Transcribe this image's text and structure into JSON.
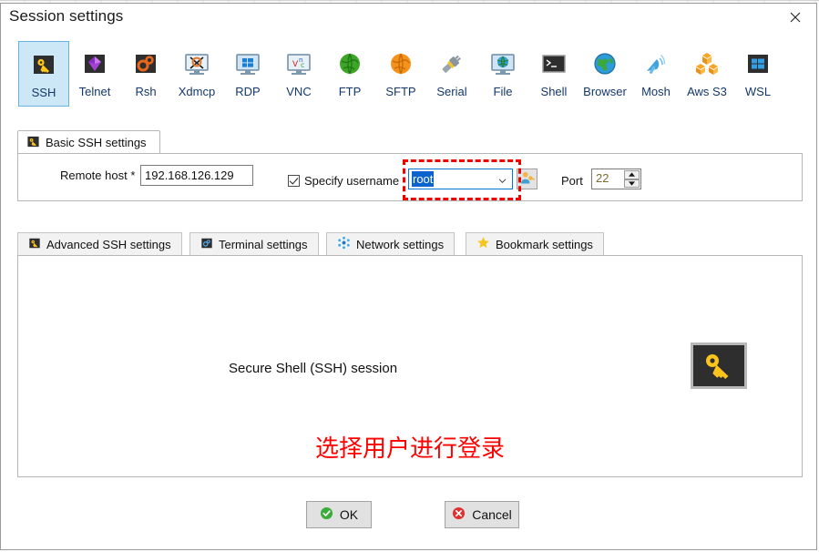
{
  "window": {
    "title": "Session settings",
    "close_icon": "close-icon"
  },
  "protocols": [
    {
      "label": "SSH",
      "icon": "ssh-key-icon",
      "selected": true
    },
    {
      "label": "Telnet",
      "icon": "telnet-gem-icon",
      "selected": false
    },
    {
      "label": "Rsh",
      "icon": "rsh-gears-icon",
      "selected": false
    },
    {
      "label": "Xdmcp",
      "icon": "xdmcp-x-icon",
      "selected": false
    },
    {
      "label": "RDP",
      "icon": "rdp-monitor-icon",
      "selected": false
    },
    {
      "label": "VNC",
      "icon": "vnc-monitor-icon",
      "selected": false
    },
    {
      "label": "FTP",
      "icon": "ftp-globe-icon",
      "selected": false
    },
    {
      "label": "SFTP",
      "icon": "sftp-globe-icon",
      "selected": false
    },
    {
      "label": "Serial",
      "icon": "serial-plug-icon",
      "selected": false
    },
    {
      "label": "File",
      "icon": "file-monitor-icon",
      "selected": false
    },
    {
      "label": "Shell",
      "icon": "shell-prompt-icon",
      "selected": false
    },
    {
      "label": "Browser",
      "icon": "browser-globe-icon",
      "selected": false
    },
    {
      "label": "Mosh",
      "icon": "mosh-dish-icon",
      "selected": false
    },
    {
      "label": "Aws S3",
      "icon": "aws-s3-cubes-icon",
      "selected": false
    },
    {
      "label": "WSL",
      "icon": "wsl-windows-icon",
      "selected": false
    }
  ],
  "basic_tab": {
    "label": "Basic SSH settings",
    "icon": "ssh-key-icon"
  },
  "basic_settings": {
    "remote_host_label": "Remote host *",
    "remote_host_value": "192.168.126.129",
    "remote_host_placeholder": "Remote host",
    "specify_username_label": "Specify username",
    "specify_username_checked": true,
    "username_value": "root",
    "username_placeholder": "username",
    "username_dropdown_icon": "chevron-down-icon",
    "select_user_button_icon": "user-key-icon",
    "port_label": "Port",
    "port_value": "22",
    "port_up_icon": "spinner-up-icon",
    "port_down_icon": "spinner-down-icon"
  },
  "sub_tabs": [
    {
      "label": "Advanced SSH settings",
      "icon": "ssh-key-icon"
    },
    {
      "label": "Terminal settings",
      "icon": "terminal-icon"
    },
    {
      "label": "Network settings",
      "icon": "network-nodes-icon"
    },
    {
      "label": "Bookmark settings",
      "icon": "star-icon"
    }
  ],
  "content": {
    "session_title": "Secure Shell (SSH) session",
    "session_icon": "ssh-key-large-icon"
  },
  "annotations": {
    "username_highlight_color": "#ff0000",
    "callout_text": "选择用户进行登录",
    "callout_color": "#ff0000"
  },
  "footer": {
    "ok_label": "OK",
    "ok_icon": "check-circle-icon",
    "cancel_label": "Cancel",
    "cancel_icon": "x-circle-icon"
  },
  "colors": {
    "selection_blue": "#cce8f6",
    "selection_border": "#6ab2dc",
    "label_blue": "#14386b",
    "focus_blue": "#0078d7"
  }
}
